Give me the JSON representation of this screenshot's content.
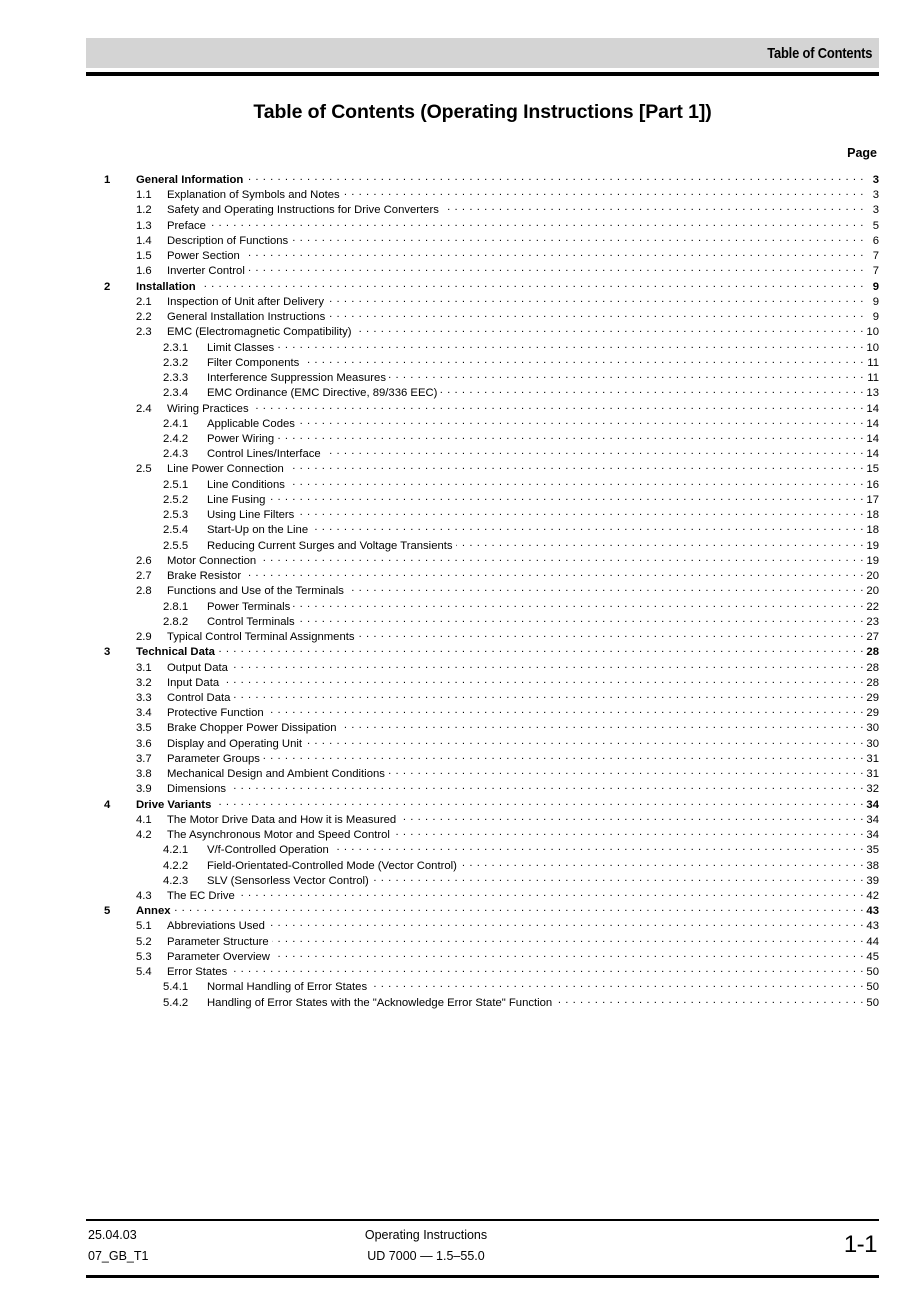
{
  "header": {
    "running_title": "Table of Contents"
  },
  "title": "Table of Contents (Operating Instructions [Part 1])",
  "page_column_header": "Page",
  "toc": [
    {
      "level": 1,
      "number": "1",
      "title": "General Information",
      "page": "3"
    },
    {
      "level": 2,
      "number": "1.1",
      "title": "Explanation of Symbols and Notes",
      "page": "3"
    },
    {
      "level": 2,
      "number": "1.2",
      "title": "Safety and Operating Instructions for Drive Converters",
      "page": "3"
    },
    {
      "level": 2,
      "number": "1.3",
      "title": "Preface",
      "page": "5"
    },
    {
      "level": 2,
      "number": "1.4",
      "title": "Description of Functions",
      "page": "6"
    },
    {
      "level": 2,
      "number": "1.5",
      "title": "Power Section",
      "page": "7"
    },
    {
      "level": 2,
      "number": "1.6",
      "title": "Inverter Control",
      "page": "7"
    },
    {
      "level": 1,
      "number": "2",
      "title": "Installation",
      "page": "9"
    },
    {
      "level": 2,
      "number": "2.1",
      "title": "Inspection of Unit after Delivery",
      "page": "9"
    },
    {
      "level": 2,
      "number": "2.2",
      "title": "General Installation Instructions",
      "page": "9"
    },
    {
      "level": 2,
      "number": "2.3",
      "title": "EMC (Electromagnetic Compatibility)",
      "page": "10"
    },
    {
      "level": 3,
      "number": "2.3.1",
      "title": "Limit Classes",
      "page": "10"
    },
    {
      "level": 3,
      "number": "2.3.2",
      "title": "Filter Components",
      "page": "11"
    },
    {
      "level": 3,
      "number": "2.3.3",
      "title": "Interference Suppression Measures",
      "page": "11"
    },
    {
      "level": 3,
      "number": "2.3.4",
      "title": "EMC Ordinance (EMC Directive, 89/336 EEC)",
      "page": "13"
    },
    {
      "level": 2,
      "number": "2.4",
      "title": "Wiring Practices",
      "page": "14"
    },
    {
      "level": 3,
      "number": "2.4.1",
      "title": "Applicable Codes",
      "page": "14"
    },
    {
      "level": 3,
      "number": "2.4.2",
      "title": "Power Wiring",
      "page": "14"
    },
    {
      "level": 3,
      "number": "2.4.3",
      "title": "Control Lines/Interface",
      "page": "14"
    },
    {
      "level": 2,
      "number": "2.5",
      "title": "Line Power Connection",
      "page": "15"
    },
    {
      "level": 3,
      "number": "2.5.1",
      "title": "Line Conditions",
      "page": "16"
    },
    {
      "level": 3,
      "number": "2.5.2",
      "title": "Line Fusing",
      "page": "17"
    },
    {
      "level": 3,
      "number": "2.5.3",
      "title": "Using Line Filters",
      "page": "18"
    },
    {
      "level": 3,
      "number": "2.5.4",
      "title": "Start-Up on the Line",
      "page": "18"
    },
    {
      "level": 3,
      "number": "2.5.5",
      "title": "Reducing Current Surges and Voltage Transients",
      "page": "19"
    },
    {
      "level": 2,
      "number": "2.6",
      "title": "Motor Connection",
      "page": "19"
    },
    {
      "level": 2,
      "number": "2.7",
      "title": "Brake Resistor",
      "page": "20"
    },
    {
      "level": 2,
      "number": "2.8",
      "title": "Functions and Use of the Terminals",
      "page": "20"
    },
    {
      "level": 3,
      "number": "2.8.1",
      "title": "Power Terminals",
      "page": "22"
    },
    {
      "level": 3,
      "number": "2.8.2",
      "title": "Control Terminals",
      "page": "23"
    },
    {
      "level": 2,
      "number": "2.9",
      "title": "Typical Control Terminal Assignments",
      "page": "27"
    },
    {
      "level": 1,
      "number": "3",
      "title": "Technical Data",
      "page": "28"
    },
    {
      "level": 2,
      "number": "3.1",
      "title": "Output Data",
      "page": "28"
    },
    {
      "level": 2,
      "number": "3.2",
      "title": "Input Data",
      "page": "28"
    },
    {
      "level": 2,
      "number": "3.3",
      "title": "Control Data",
      "page": "29"
    },
    {
      "level": 2,
      "number": "3.4",
      "title": "Protective Function",
      "page": "29"
    },
    {
      "level": 2,
      "number": "3.5",
      "title": "Brake Chopper Power Dissipation",
      "page": "30"
    },
    {
      "level": 2,
      "number": "3.6",
      "title": "Display and Operating Unit",
      "page": "30"
    },
    {
      "level": 2,
      "number": "3.7",
      "title": "Parameter Groups",
      "page": "31"
    },
    {
      "level": 2,
      "number": "3.8",
      "title": "Mechanical Design and Ambient Conditions",
      "page": "31"
    },
    {
      "level": 2,
      "number": "3.9",
      "title": "Dimensions",
      "page": "32"
    },
    {
      "level": 1,
      "number": "4",
      "title": "Drive Variants",
      "page": "34"
    },
    {
      "level": 2,
      "number": "4.1",
      "title": "The Motor Drive Data and How it is Measured",
      "page": "34"
    },
    {
      "level": 2,
      "number": "4.2",
      "title": "The Asynchronous Motor and Speed Control",
      "page": "34"
    },
    {
      "level": 3,
      "number": "4.2.1",
      "title": "V/f-Controlled Operation",
      "page": "35"
    },
    {
      "level": 3,
      "number": "4.2.2",
      "title": "Field-Orientated-Controlled Mode (Vector Control)",
      "page": "38"
    },
    {
      "level": 3,
      "number": "4.2.3",
      "title": "SLV (Sensorless Vector Control)",
      "page": "39"
    },
    {
      "level": 2,
      "number": "4.3",
      "title": "The EC Drive",
      "page": "42"
    },
    {
      "level": 1,
      "number": "5",
      "title": "Annex",
      "page": "43"
    },
    {
      "level": 2,
      "number": "5.1",
      "title": "Abbreviations Used",
      "page": "43"
    },
    {
      "level": 2,
      "number": "5.2",
      "title": "Parameter Structure",
      "page": "44"
    },
    {
      "level": 2,
      "number": "5.3",
      "title": "Parameter Overview",
      "page": "45"
    },
    {
      "level": 2,
      "number": "5.4",
      "title": "Error States",
      "page": "50"
    },
    {
      "level": 3,
      "number": "5.4.1",
      "title": "Normal Handling of Error States",
      "page": "50"
    },
    {
      "level": 3,
      "number": "5.4.2",
      "title": "Handling of Error States with the \"Acknowledge Error State\" Function",
      "page": "50"
    }
  ],
  "footer": {
    "date": "25.04.03",
    "doc_code": "07_GB_T1",
    "center_line1": "Operating Instructions",
    "center_line2": "UD 7000 — 1.5–55.0",
    "page_number": "1-1"
  },
  "colors": {
    "header_bar_background": "#d4d4d4",
    "rule": "#000000",
    "text": "#000000",
    "page_background": "#ffffff"
  }
}
